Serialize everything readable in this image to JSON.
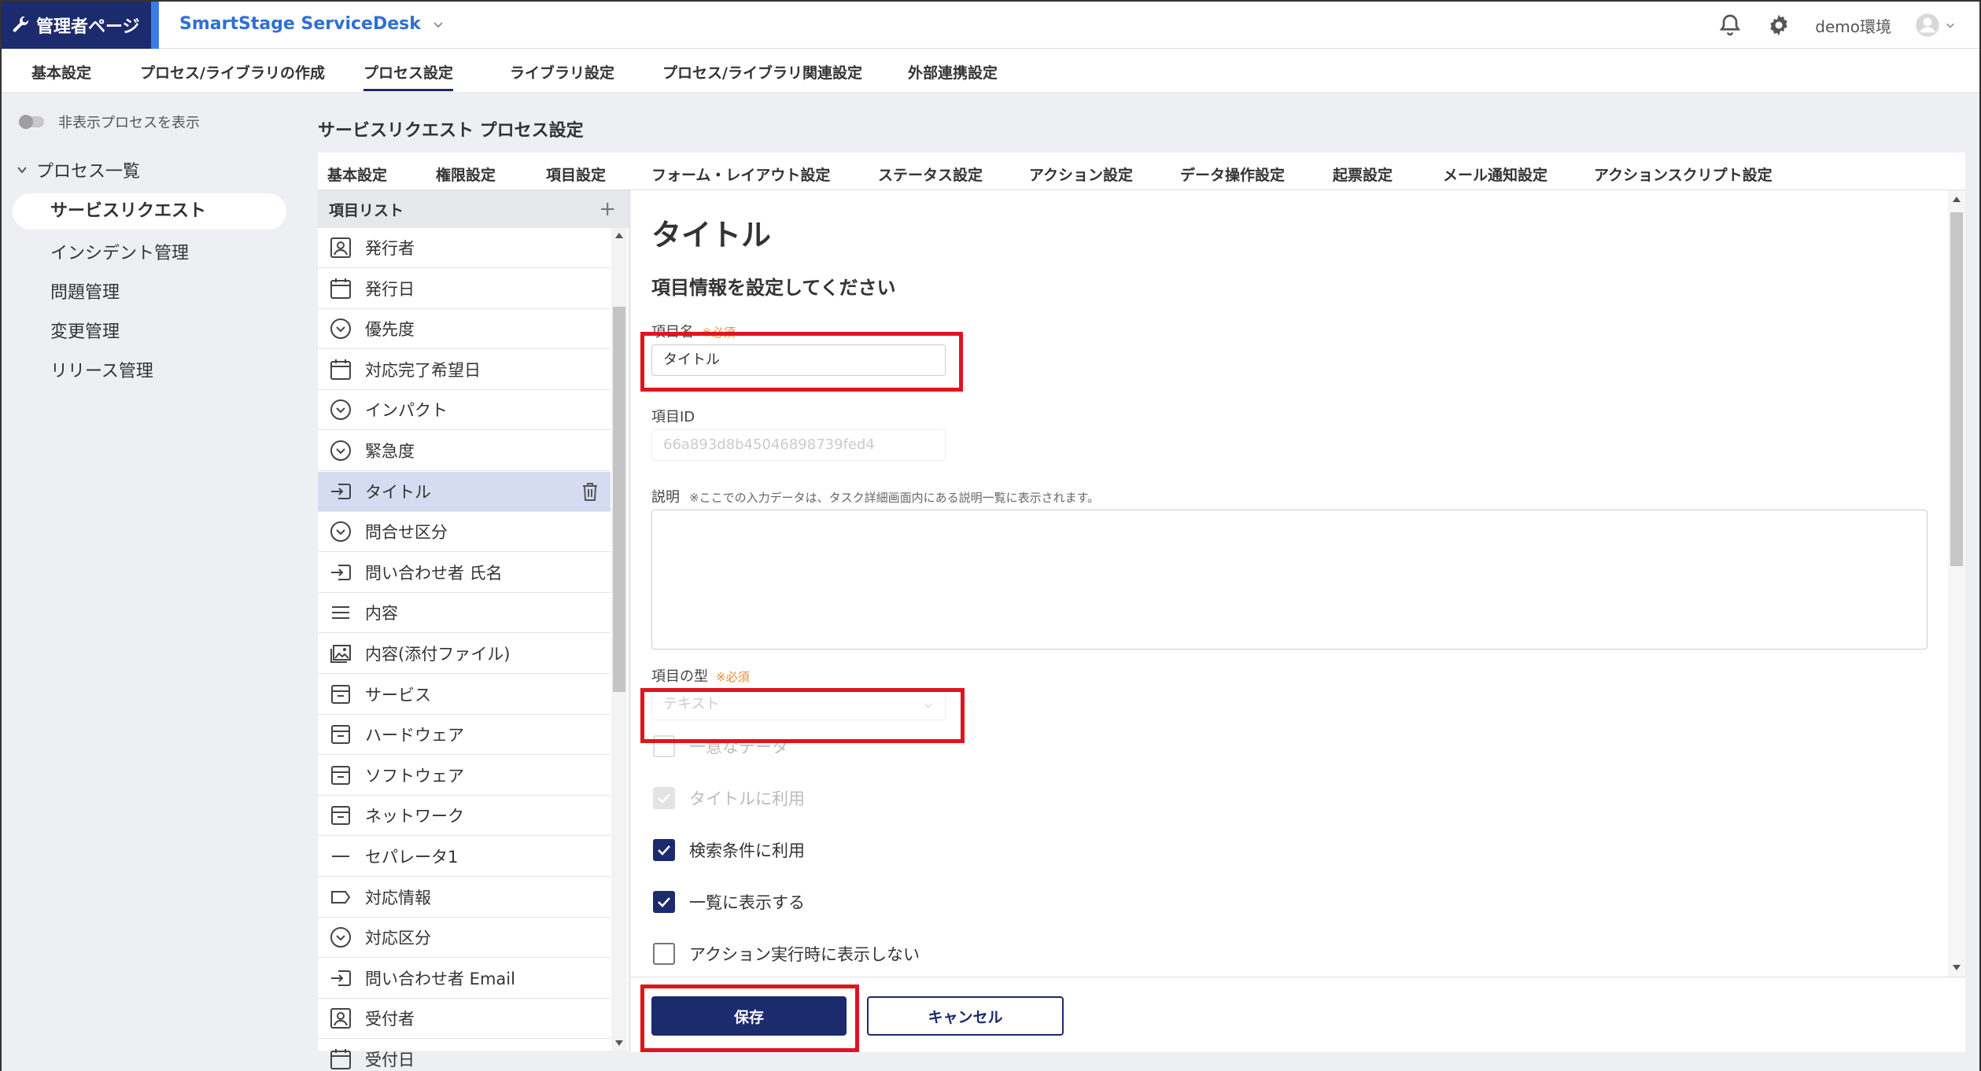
{
  "header": {
    "admin_label": "管理者ページ",
    "app_title": "SmartStage ServiceDesk",
    "env_label": "demo環境"
  },
  "topnav": [
    "基本設定",
    "プロセス/ライブラリの作成",
    "プロセス設定",
    "ライブラリ設定",
    "プロセス/ライブラリ関連設定",
    "外部連携設定"
  ],
  "sidebar": {
    "toggle_label": "非表示プロセスを表示",
    "section_title": "プロセス一覧",
    "items": [
      "サービスリクエスト",
      "インシデント管理",
      "問題管理",
      "変更管理",
      "リリース管理"
    ]
  },
  "main": {
    "page_title": "サービスリクエスト プロセス設定",
    "subtabs": [
      "基本設定",
      "権限設定",
      "項目設定",
      "フォーム・レイアウト設定",
      "ステータス設定",
      "アクション設定",
      "データ操作設定",
      "起票設定",
      "メール通知設定",
      "アクションスクリプト設定"
    ]
  },
  "itemlist": {
    "header": "項目リスト",
    "add": "+",
    "items": [
      {
        "label": "発行者",
        "icon": "person"
      },
      {
        "label": "発行日",
        "icon": "calendar"
      },
      {
        "label": "優先度",
        "icon": "dropdown"
      },
      {
        "label": "対応完了希望日",
        "icon": "calendar"
      },
      {
        "label": "インパクト",
        "icon": "dropdown"
      },
      {
        "label": "緊急度",
        "icon": "dropdown"
      },
      {
        "label": "タイトル",
        "icon": "input"
      },
      {
        "label": "問合せ区分",
        "icon": "dropdown"
      },
      {
        "label": "問い合わせ者 氏名",
        "icon": "input"
      },
      {
        "label": "内容",
        "icon": "lines"
      },
      {
        "label": "内容(添付ファイル)",
        "icon": "image"
      },
      {
        "label": "サービス",
        "icon": "box"
      },
      {
        "label": "ハードウェア",
        "icon": "box"
      },
      {
        "label": "ソフトウェア",
        "icon": "box"
      },
      {
        "label": "ネットワーク",
        "icon": "box"
      },
      {
        "label": "セパレータ1",
        "icon": "dash"
      },
      {
        "label": "対応情報",
        "icon": "tag"
      },
      {
        "label": "対応区分",
        "icon": "dropdown"
      },
      {
        "label": "問い合わせ者 Email",
        "icon": "input"
      },
      {
        "label": "受付者",
        "icon": "person"
      },
      {
        "label": "受付日",
        "icon": "calendar"
      }
    ]
  },
  "detail": {
    "title": "タイトル",
    "subtitle": "項目情報を設定してください",
    "name_label": "項目名",
    "required": "※必須",
    "name_value": "タイトル",
    "id_label": "項目ID",
    "id_value": "66a893d8b45046898739fed4",
    "desc_label": "説明",
    "desc_note": "※ここでの入力データは、タスク詳細画面内にある説明一覧に表示されます。",
    "type_label": "項目の型",
    "type_value": "テキスト",
    "checks": [
      {
        "label": "一意なデータ",
        "checked": false,
        "disabled": true
      },
      {
        "label": "タイトルに利用",
        "checked": true,
        "disabled": true
      },
      {
        "label": "検索条件に利用",
        "checked": true,
        "disabled": false
      },
      {
        "label": "一覧に表示する",
        "checked": true,
        "disabled": false
      },
      {
        "label": "アクション実行時に表示しない",
        "checked": false,
        "disabled": false
      }
    ]
  },
  "footer": {
    "save": "保存",
    "cancel": "キャンセル"
  },
  "colors": {
    "primary": "#1c2a6e",
    "accent": "#3a7be8",
    "highlight": "#e0141e",
    "required": "#f08a2c"
  }
}
